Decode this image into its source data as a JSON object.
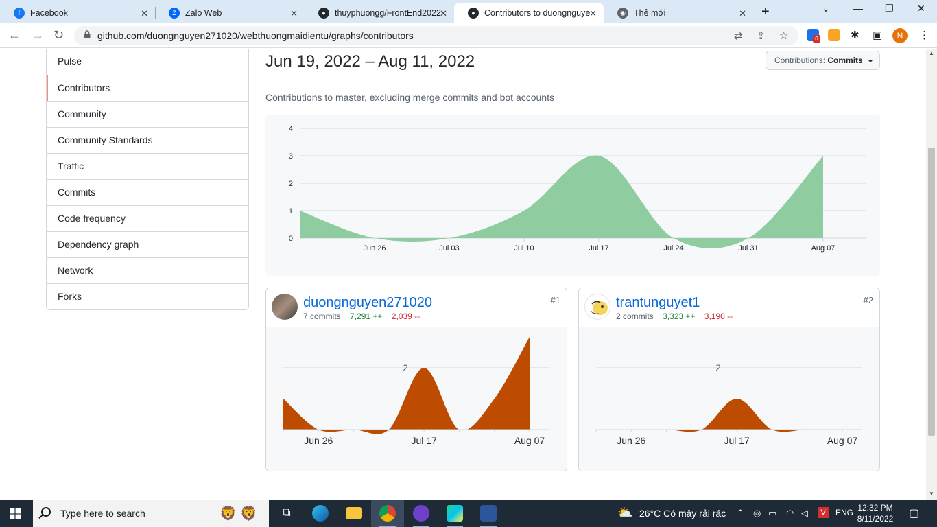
{
  "browser": {
    "tabs": [
      {
        "title": "Facebook",
        "icon": "facebook-icon",
        "color": "#1877f2"
      },
      {
        "title": "Zalo Web",
        "icon": "zalo-icon",
        "color": "#0068ff"
      },
      {
        "title": "thuyphuongg/FrontEnd2022",
        "icon": "github-icon",
        "color": "#24292f"
      },
      {
        "title": "Contributors to duongnguye",
        "icon": "github-icon",
        "color": "#24292f"
      },
      {
        "title": "Thẻ mới",
        "icon": "chrome-icon",
        "color": "#5f6368"
      }
    ],
    "active_tab": 3,
    "url": "github.com/duongnguyen271020/webthuongmaidientu/graphs/contributors",
    "extension_badge": "0",
    "profile_initial": "N"
  },
  "insights_nav": {
    "items": [
      "Pulse",
      "Contributors",
      "Community",
      "Community Standards",
      "Traffic",
      "Commits",
      "Code frequency",
      "Dependency graph",
      "Network",
      "Forks"
    ],
    "selected": "Contributors"
  },
  "header": {
    "date_range": "Jun 19, 2022 – Aug 11, 2022",
    "contributions_label": "Contributions:",
    "contributions_value": "Commits",
    "subtitle": "Contributions to master, excluding merge commits and bot accounts"
  },
  "chart_data": [
    {
      "type": "area",
      "color": "#8fcc9f",
      "x": [
        "Jun 19",
        "Jun 26",
        "Jul 03",
        "Jul 10",
        "Jul 17",
        "Jul 24",
        "Jul 31",
        "Aug 07"
      ],
      "y": [
        1,
        0,
        0,
        1,
        3,
        0,
        0,
        3
      ],
      "x_ticks": [
        "Jun 26",
        "Jul 03",
        "Jul 10",
        "Jul 17",
        "Jul 24",
        "Jul 31",
        "Aug 07"
      ],
      "y_ticks": [
        0,
        1,
        2,
        3,
        4
      ],
      "ylim": [
        0,
        4
      ],
      "grid": true
    },
    {
      "type": "area",
      "color": "#bd4b00",
      "x": [
        "Jun 19",
        "Jun 26",
        "Jul 03",
        "Jul 10",
        "Jul 17",
        "Jul 24",
        "Jul 31",
        "Aug 07"
      ],
      "y": [
        1,
        0,
        0,
        0,
        2,
        0,
        1,
        3
      ],
      "x_ticks": [
        "Jun 26",
        "Jul 17",
        "Aug 07"
      ],
      "gridline_label": "2",
      "grid": true
    },
    {
      "type": "area",
      "color": "#bd4b00",
      "x": [
        "Jun 19",
        "Jun 26",
        "Jul 03",
        "Jul 10",
        "Jul 17",
        "Jul 24",
        "Jul 31",
        "Aug 07"
      ],
      "y": [
        0,
        0,
        0,
        0,
        1,
        0,
        0,
        0
      ],
      "x_ticks": [
        "Jun 26",
        "Jul 17",
        "Aug 07"
      ],
      "gridline_label": "2",
      "grid": true
    }
  ],
  "contributors": [
    {
      "username": "duongnguyen271020",
      "commits": "7 commits",
      "additions": "7,291 ++",
      "deletions": "2,039 --",
      "rank": "#1"
    },
    {
      "username": "trantunguyet1",
      "commits": "2 commits",
      "additions": "3,323 ++",
      "deletions": "3,190 --",
      "rank": "#2"
    }
  ],
  "taskbar": {
    "search_placeholder": "Type here to search",
    "weather": "26°C  Có mây rải rác",
    "language": "ENG",
    "time": "12:32 PM",
    "date": "8/11/2022"
  }
}
